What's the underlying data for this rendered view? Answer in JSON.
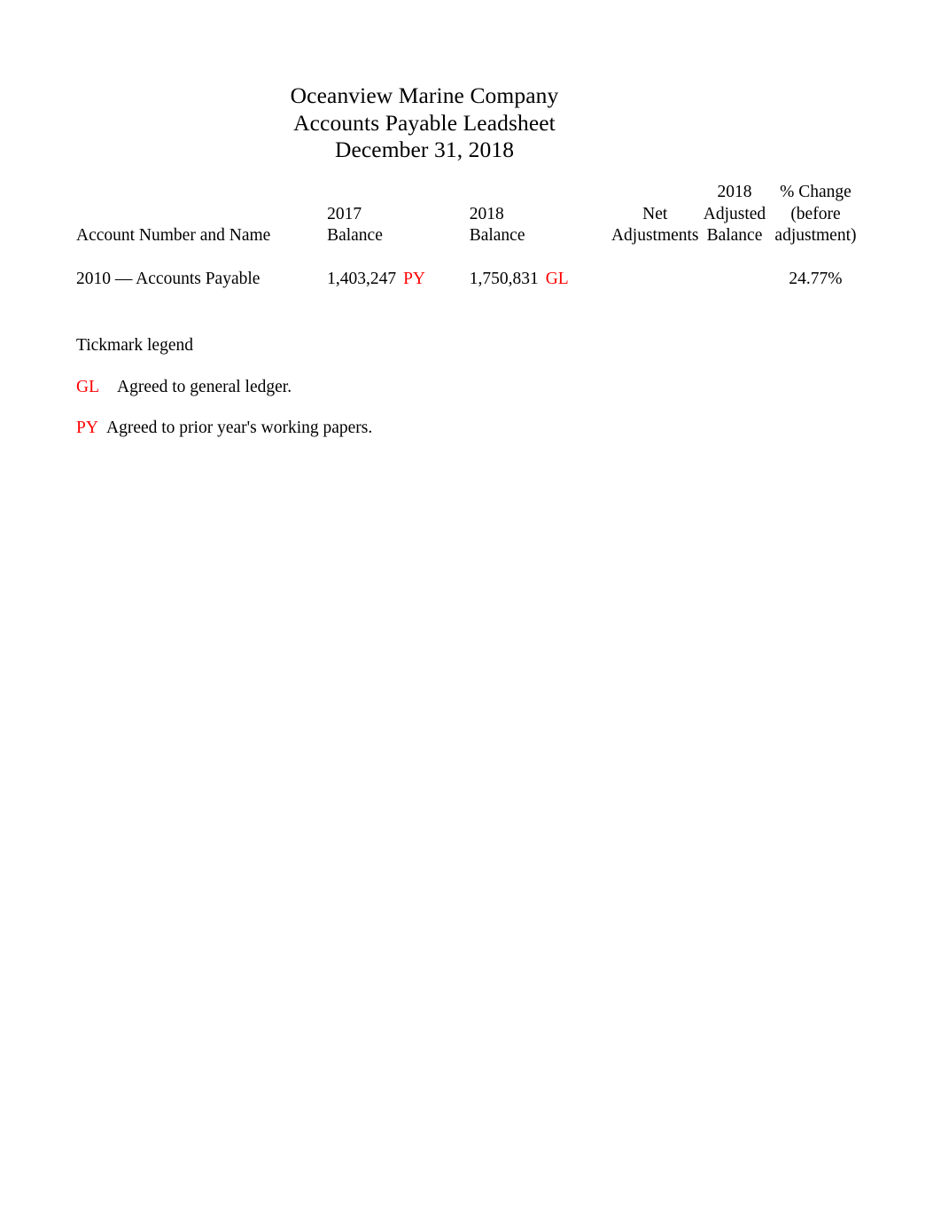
{
  "document": {
    "title_lines": [
      "Oceanview Marine Company",
      "Accounts Payable Leadsheet",
      "December 31, 2018"
    ],
    "company": "Oceanview Marine Company",
    "schedule": "Accounts Payable Leadsheet",
    "date": "December 31, 2018"
  },
  "table": {
    "headers": {
      "account": {
        "line1": "",
        "line2": "",
        "line3": "Account Number and Name"
      },
      "balance_2017": {
        "line1": "",
        "line2": "2017",
        "line3": "Balance"
      },
      "balance_2018": {
        "line1": "",
        "line2": "2018",
        "line3": "Balance"
      },
      "net_adjustments": {
        "line1": "",
        "line2": "Net",
        "line3": "Adjustments"
      },
      "adjusted_balance_2018": {
        "line1": "2018",
        "line2": "Adjusted",
        "line3": "Balance"
      },
      "percent_change": {
        "line1": "% Change",
        "line2": "(before",
        "line3": "adjustment)"
      }
    },
    "rows": [
      {
        "account": "2010 — Accounts Payable",
        "balance_2017": "1,403,247",
        "balance_2017_tick": "PY",
        "balance_2018": "1,750,831",
        "balance_2018_tick": "GL",
        "net_adjustments": "",
        "adjusted_balance_2018": "",
        "percent_change": "24.77%"
      }
    ]
  },
  "legend": {
    "title": "Tickmark legend",
    "entries": [
      {
        "mark": "GL",
        "text": "Agreed to general ledger."
      },
      {
        "mark": "PY",
        "text": "Agreed to prior year's working papers."
      }
    ]
  },
  "colors": {
    "tickmark_red": "#ff0000",
    "text_black": "#000000",
    "page_background": "#ffffff"
  }
}
